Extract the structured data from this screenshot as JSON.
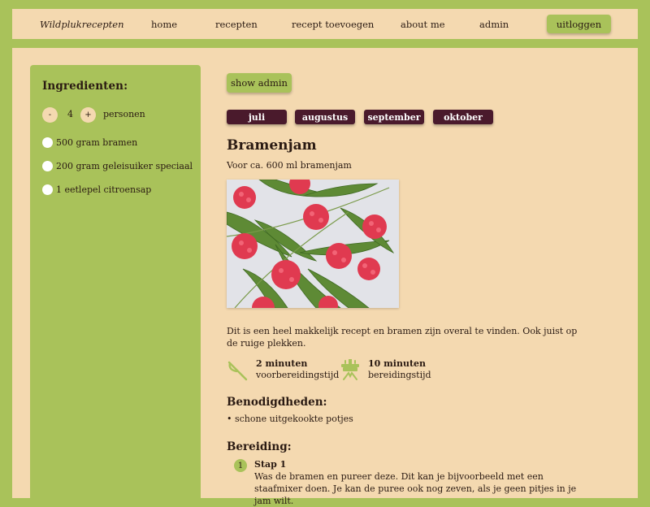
{
  "nav": {
    "brand": "Wildplukrecepten",
    "items": [
      "home",
      "recepten",
      "recept toevoegen",
      "about me",
      "admin"
    ],
    "logout": "uitloggen"
  },
  "sidebar": {
    "title": "Ingredienten:",
    "decrement": "-",
    "increment": "+",
    "persons_count": "4",
    "persons_label": "personen",
    "ingredients": [
      "500 gram bramen",
      "200 gram geleisuiker speciaal",
      "1 eetlepel citroensap"
    ]
  },
  "admin_toggle": "show admin",
  "months": [
    "juli",
    "augustus",
    "september",
    "oktober"
  ],
  "recipe": {
    "title": "Bramenjam",
    "yield": "Voor ca. 600 ml bramenjam",
    "description": "Dit is een heel makkelijk recept en bramen zijn overal te vinden. Ook juist op de ruige plekken.",
    "prep_time": "2 minuten",
    "prep_label": "voorbereidingstijd",
    "cook_time": "10 minuten",
    "cook_label": "bereidingstijd",
    "tools_title": "Benodigdheden:",
    "tools": [
      "schone uitgekookte potjes"
    ],
    "steps_title": "Bereiding:",
    "steps": [
      {
        "number": "1",
        "title": "Stap 1",
        "text": "Was de bramen en pureer deze. Dit kan je bijvoorbeeld met een staafmixer doen. Je kan de puree ook nog zeven, als je geen pitjes in je jam wilt."
      }
    ]
  },
  "colors": {
    "green": "#a9c25a",
    "beige": "#f4d9b0",
    "month_bg": "#4a1a2c"
  },
  "icons": [
    "knife-icon",
    "stove-icon"
  ]
}
